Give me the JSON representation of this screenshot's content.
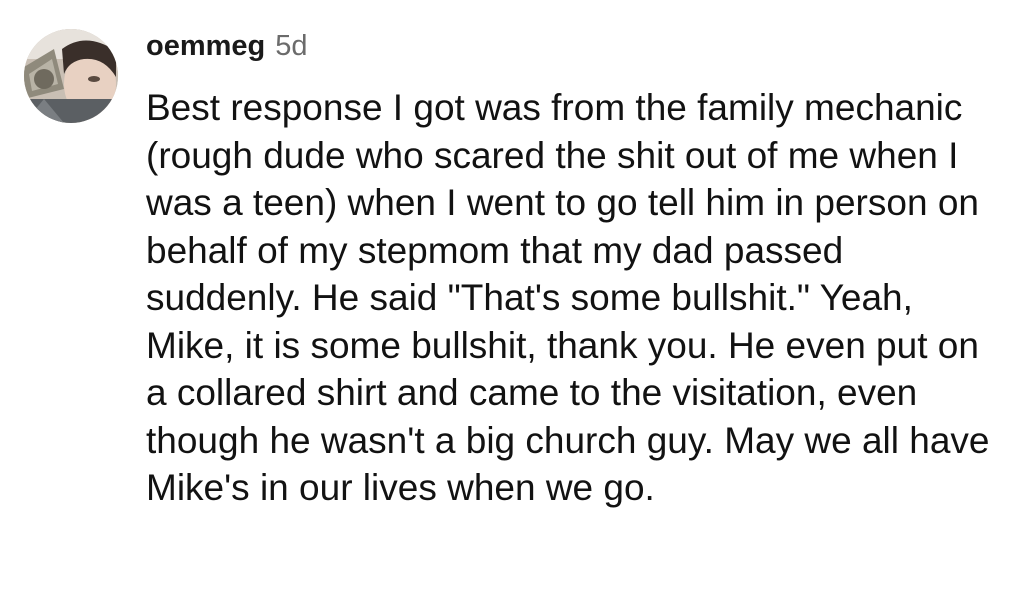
{
  "comment": {
    "username": "oemmeg",
    "age": "5d",
    "avatar_icon": "user-avatar-photo",
    "text": "Best response I got was from the family mechanic (rough dude who scared the shit out of me when I was a teen) when I went to go tell him in person on behalf of my stepmom that my dad passed suddenly. He said \"That's some bullshit.\" Yeah, Mike, it is some bullshit, thank you. He even put on a collared shirt and came to the visitation, even though he wasn't a big church guy. May we all have Mike's in our lives when we go."
  }
}
